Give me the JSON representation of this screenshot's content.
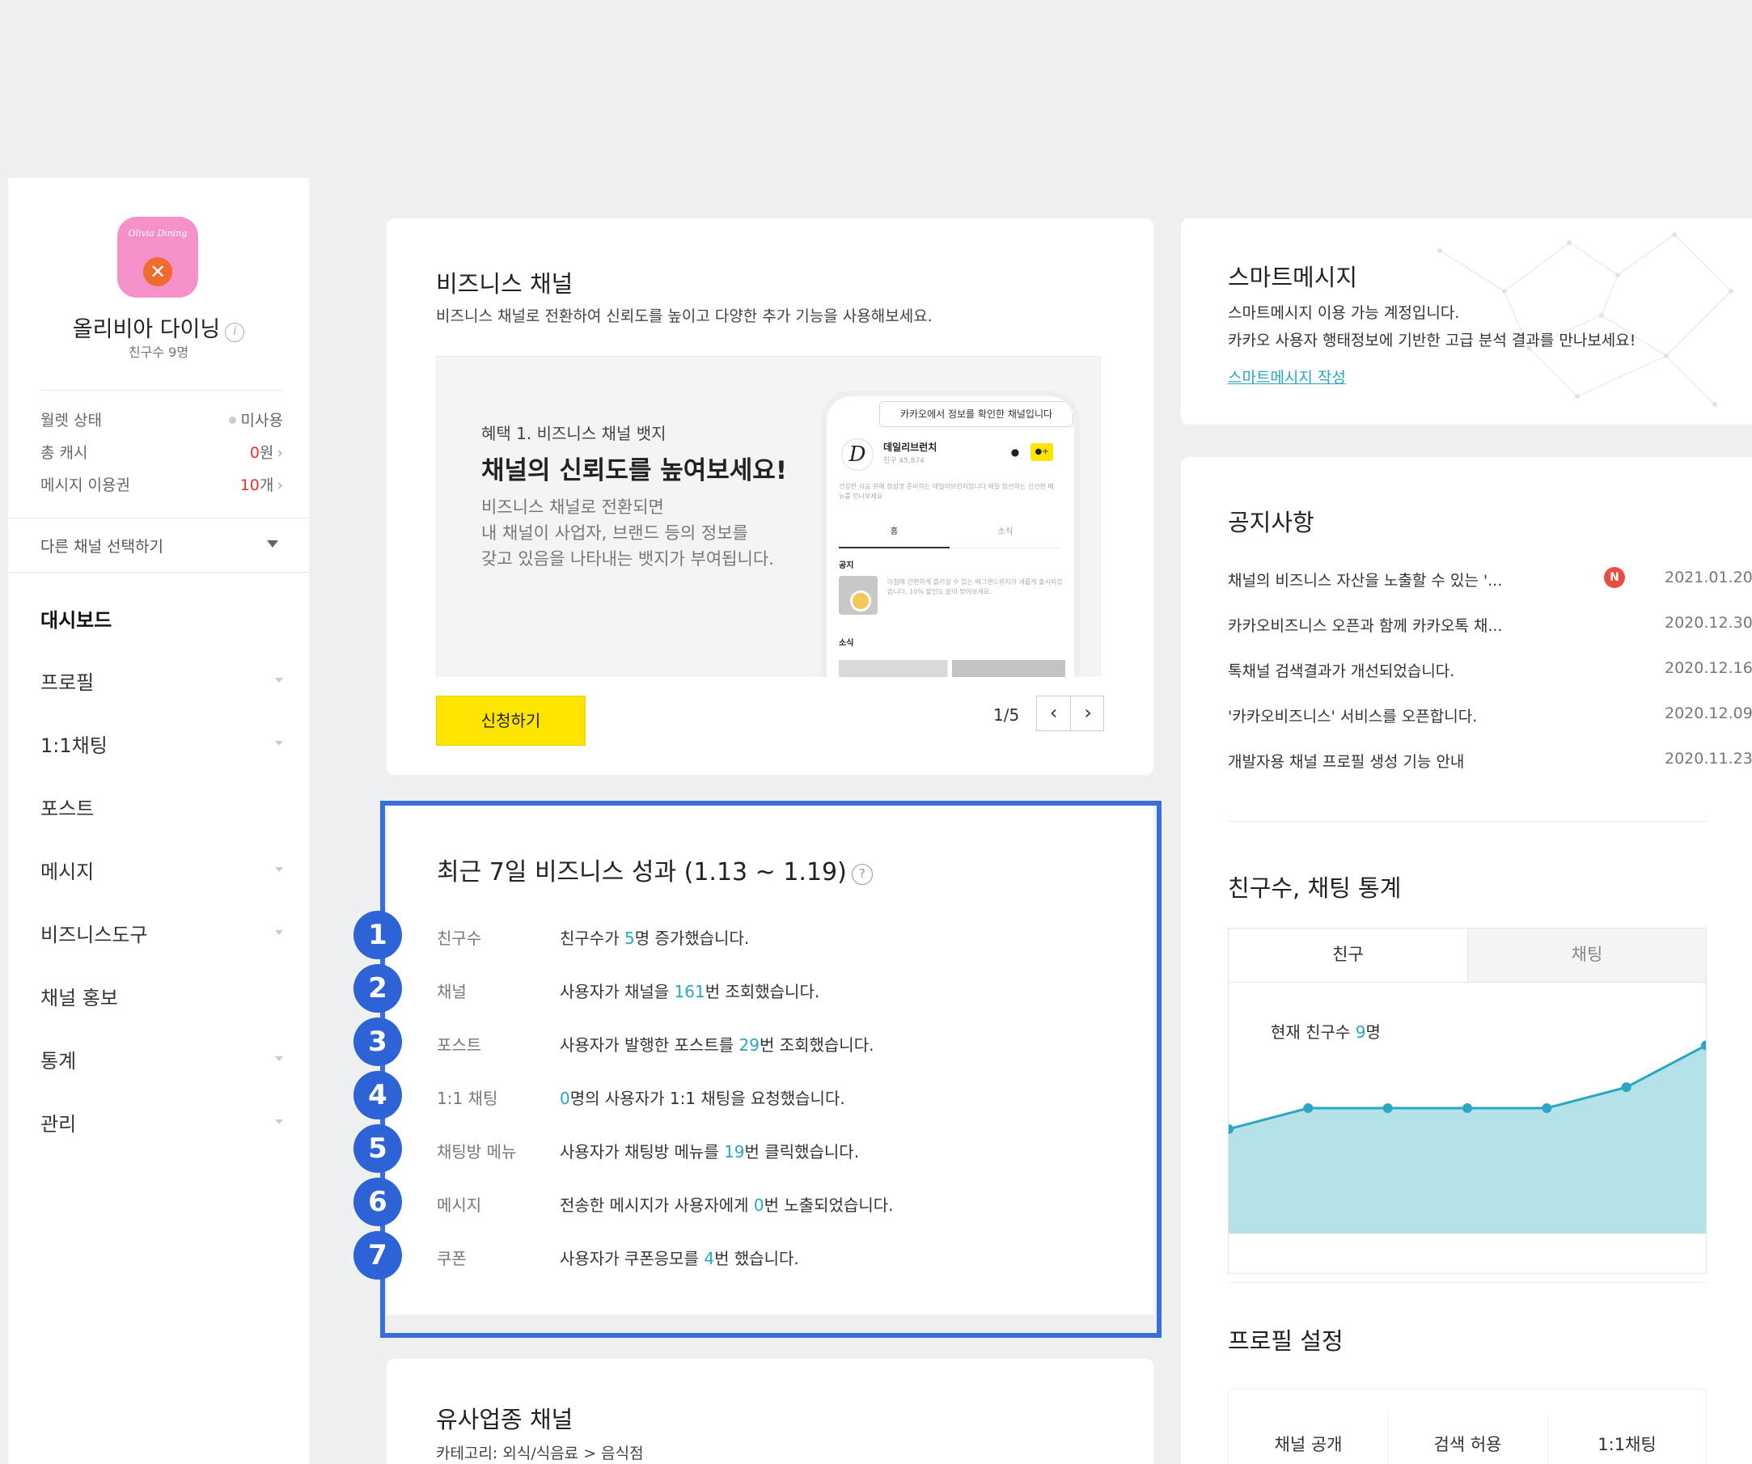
{
  "sidebar": {
    "avatar_brand": "Olivia Dining",
    "channel_name": "올리비아 다이닝",
    "friends": "친구수 9명",
    "wallet": {
      "label": "월렛 상태",
      "value": "미사용"
    },
    "cash": {
      "label": "총 캐시",
      "value": "0",
      "unit": "원"
    },
    "voucher": {
      "label": "메시지 이용권",
      "value": "10",
      "unit": "개"
    },
    "select_channel": "다른 채널 선택하기",
    "nav": [
      {
        "label": "대시보드",
        "active": true
      },
      {
        "label": "프로필",
        "expandable": true
      },
      {
        "label": "1:1채팅",
        "expandable": true
      },
      {
        "label": "포스트",
        "expandable": false
      },
      {
        "label": "메시지",
        "expandable": true
      },
      {
        "label": "비즈니스도구",
        "expandable": true
      },
      {
        "label": "채널 홍보",
        "expandable": false
      },
      {
        "label": "통계",
        "expandable": true
      },
      {
        "label": "관리",
        "expandable": true
      }
    ]
  },
  "biz_channel": {
    "title": "비즈니스 채널",
    "desc": "비즈니스 채널로 전환하여 신뢰도를 높이고 다양한 추가 기능을 사용해보세요.",
    "benefit": "혜택 1. 비즈니스 채널 뱃지",
    "headline": "채널의 신뢰도를 높여보세요!",
    "body_lines": [
      "비즈니스 채널로 전환되면",
      "내 채널이 사업자, 브랜드 등의 정보를",
      "갖고 있음을 나타내는 뱃지가 부여됩니다."
    ],
    "phone": {
      "tooltip": "카카오에서 정보를 확인한 채널입니다",
      "name": "데일리브런치",
      "sub": "친구 45,874",
      "text": "건강한 식음 위해 정성껏 준비하는 데일리브런치입니다 매일 엄선하는 신선한 메뉴를 만나보세요",
      "tab_home": "홈",
      "tab_news": "소식",
      "section_notice": "공지",
      "notice_text": "아침에 간편하게 즐기실 수 있는 에그샌드위치가 새롭게 출시되었습니다. 10% 할인도 같이 받아보세요.",
      "section_news": "소식"
    },
    "apply": "신청하기",
    "pager": "1/5"
  },
  "performance": {
    "title": "최근 7일 비즈니스 성과 (1.13 ~ 1.19)",
    "rows": [
      {
        "num": "1",
        "key": "친구수",
        "pre": "친구수가 ",
        "hl": "5",
        "post": "명 증가했습니다."
      },
      {
        "num": "2",
        "key": "채널",
        "pre": "사용자가 채널을 ",
        "hl": "161",
        "post": "번 조회했습니다."
      },
      {
        "num": "3",
        "key": "포스트",
        "pre": "사용자가 발행한 포스트를 ",
        "hl": "29",
        "post": "번 조회했습니다."
      },
      {
        "num": "4",
        "key": "1:1 채팅",
        "pre": "",
        "hl": "0",
        "post": "명의 사용자가 1:1 채팅을 요청했습니다."
      },
      {
        "num": "5",
        "key": "채팅방 메뉴",
        "pre": "사용자가 채팅방 메뉴를 ",
        "hl": "19",
        "post": "번 클릭했습니다."
      },
      {
        "num": "6",
        "key": "메시지",
        "pre": "전송한 메시지가 사용자에게 ",
        "hl": "0",
        "post": "번 노출되었습니다."
      },
      {
        "num": "7",
        "key": "쿠폰",
        "pre": "사용자가 쿠폰응모를 ",
        "hl": "4",
        "post": "번 했습니다."
      }
    ]
  },
  "similar": {
    "title": "유사업종 채널",
    "category": "카테고리: 외식/식음료 > 음식점"
  },
  "smart_message": {
    "title": "스마트메시지",
    "line1": "스마트메시지 이용 가능 계정입니다.",
    "line2": "카카오 사용자 행태정보에 기반한 고급 분석 결과를 만나보세요!",
    "link": "스마트메시지 작성"
  },
  "notices": {
    "title": "공지사항",
    "items": [
      {
        "text": "채널의 비즈니스 자산을 노출할 수 있는 '...",
        "date": "2021.01.20",
        "new": "N"
      },
      {
        "text": "카카오비즈니스 오픈과 함께 카카오톡 채...",
        "date": "2020.12.30"
      },
      {
        "text": "톡채널 검색결과가 개선되었습니다.",
        "date": "2020.12.16"
      },
      {
        "text": "'카카오비즈니스' 서비스를 오픈합니다.",
        "date": "2020.12.09"
      },
      {
        "text": "개발자용 채널 프로필 생성 기능 안내",
        "date": "2020.11.23"
      }
    ]
  },
  "stats": {
    "title": "친구수, 채팅 통계",
    "tab_friends": "친구",
    "tab_chat": "채팅",
    "current_pre": "현재 친구수 ",
    "current_hl": "9",
    "current_post": "명",
    "accent_color": "#2aa7c4"
  },
  "chart_data": {
    "type": "area",
    "series": [
      {
        "values": [
          5,
          6,
          6,
          6,
          6,
          7,
          9
        ]
      }
    ],
    "ylim": [
      0,
      12
    ],
    "color": "#2aa7c4",
    "fill": "#b5e1e8"
  },
  "profile_settings": {
    "title": "프로필 설정",
    "cols": [
      "채널 공개",
      "검색 허용",
      "1:1채팅"
    ]
  },
  "colors": {
    "highlight_frame": "#3a6fd8",
    "badge": "#2d63d6",
    "apply_button": "#fee500"
  }
}
